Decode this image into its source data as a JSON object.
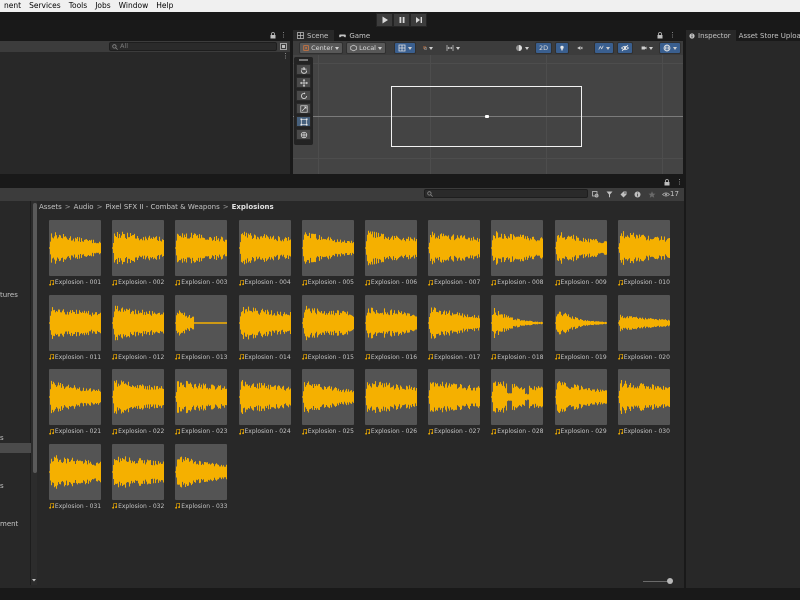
{
  "menubar": {
    "items": [
      "nent",
      "Services",
      "Tools",
      "Jobs",
      "Window",
      "Help"
    ]
  },
  "play_controls": {
    "icons": [
      "play-icon",
      "pause-icon",
      "step-icon"
    ]
  },
  "hierarchy": {
    "search_placeholder": "All"
  },
  "scene": {
    "tabs": [
      {
        "label": "Scene",
        "icon": "grid-icon"
      },
      {
        "label": "Game",
        "icon": "gamepad-icon"
      }
    ],
    "pivot_label": "Center",
    "space_label": "Local",
    "mode_2d_label": "2D"
  },
  "inspector": {
    "tabs": [
      {
        "label": "Inspector",
        "icon": "info-icon"
      },
      {
        "label": "Asset Store Uploade",
        "icon": ""
      }
    ]
  },
  "project": {
    "hidden_count": "17",
    "breadcrumb": [
      "Assets",
      "Audio",
      "Pixel SFX II - Combat & Weapons",
      "Explosions"
    ],
    "folders": [
      {
        "label": "tures",
        "row": 94
      },
      {
        "label": "s",
        "row": 237
      },
      {
        "label": "s",
        "row": 285
      },
      {
        "label": "ment",
        "row": 323
      }
    ],
    "assets": [
      "Explosion - 001",
      "Explosion - 002",
      "Explosion - 003",
      "Explosion - 004",
      "Explosion - 005",
      "Explosion - 006",
      "Explosion - 007",
      "Explosion - 008",
      "Explosion - 009",
      "Explosion - 010",
      "Explosion - 011",
      "Explosion - 012",
      "Explosion - 013",
      "Explosion - 014",
      "Explosion - 015",
      "Explosion - 016",
      "Explosion - 017",
      "Explosion - 018",
      "Explosion - 019",
      "Explosion - 020",
      "Explosion - 021",
      "Explosion - 022",
      "Explosion - 023",
      "Explosion - 024",
      "Explosion - 025",
      "Explosion - 026",
      "Explosion - 027",
      "Explosion - 028",
      "Explosion - 029",
      "Explosion - 030",
      "Explosion - 031",
      "Explosion - 032",
      "Explosion - 033"
    ]
  },
  "colors": {
    "waveform": "#f5b000",
    "panel": "#282828",
    "toolbar": "#3c3c3c",
    "viewport": "#444444",
    "selected_button": "#3a5f8f"
  }
}
